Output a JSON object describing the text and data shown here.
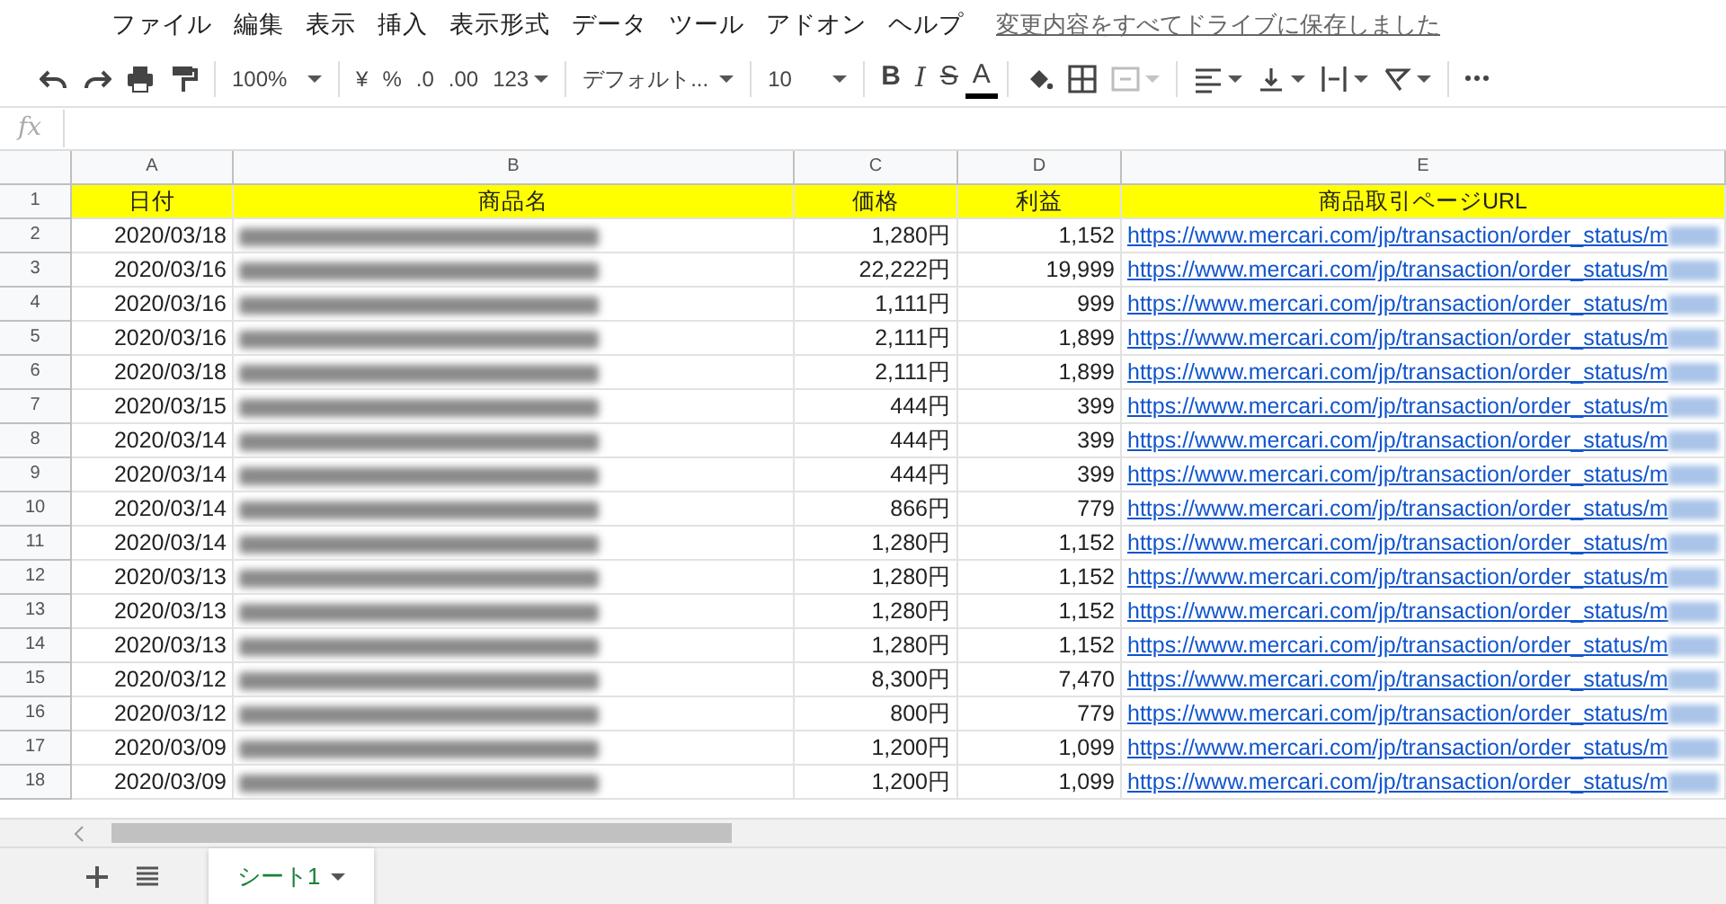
{
  "menu": [
    "ファイル",
    "編集",
    "表示",
    "挿入",
    "表示形式",
    "データ",
    "ツール",
    "アドオン",
    "ヘルプ"
  ],
  "save_status": "変更内容をすべてドライブに保存しました",
  "toolbar": {
    "zoom": "100%",
    "currency": "¥",
    "percent": "%",
    "decrease_decimals": ".0",
    "increase_decimals": ".00",
    "number_format": "123",
    "font": "デフォルト...",
    "font_size": "10",
    "bold": "B",
    "italic": "I",
    "strikethrough": "S",
    "text_color": "A",
    "merge_disabled": true
  },
  "formula_bar": {
    "label": "fx"
  },
  "columns": [
    "A",
    "B",
    "C",
    "D",
    "E"
  ],
  "header_row": {
    "number": "1",
    "cells": [
      "日付",
      "商品名",
      "価格",
      "利益",
      "商品取引ページURL"
    ]
  },
  "rows": [
    {
      "number": "2",
      "date": "2020/03/18",
      "price": "1,280円",
      "profit": "1,152",
      "url": "https://www.mercari.com/jp/transaction/order_status/m"
    },
    {
      "number": "3",
      "date": "2020/03/16",
      "price": "22,222円",
      "profit": "19,999",
      "url": "https://www.mercari.com/jp/transaction/order_status/m"
    },
    {
      "number": "4",
      "date": "2020/03/16",
      "price": "1,111円",
      "profit": "999",
      "url": "https://www.mercari.com/jp/transaction/order_status/m"
    },
    {
      "number": "5",
      "date": "2020/03/16",
      "price": "2,111円",
      "profit": "1,899",
      "url": "https://www.mercari.com/jp/transaction/order_status/m"
    },
    {
      "number": "6",
      "date": "2020/03/18",
      "price": "2,111円",
      "profit": "1,899",
      "url": "https://www.mercari.com/jp/transaction/order_status/m"
    },
    {
      "number": "7",
      "date": "2020/03/15",
      "price": "444円",
      "profit": "399",
      "url": "https://www.mercari.com/jp/transaction/order_status/m"
    },
    {
      "number": "8",
      "date": "2020/03/14",
      "price": "444円",
      "profit": "399",
      "url": "https://www.mercari.com/jp/transaction/order_status/m"
    },
    {
      "number": "9",
      "date": "2020/03/14",
      "price": "444円",
      "profit": "399",
      "url": "https://www.mercari.com/jp/transaction/order_status/m"
    },
    {
      "number": "10",
      "date": "2020/03/14",
      "price": "866円",
      "profit": "779",
      "url": "https://www.mercari.com/jp/transaction/order_status/m"
    },
    {
      "number": "11",
      "date": "2020/03/14",
      "price": "1,280円",
      "profit": "1,152",
      "url": "https://www.mercari.com/jp/transaction/order_status/m"
    },
    {
      "number": "12",
      "date": "2020/03/13",
      "price": "1,280円",
      "profit": "1,152",
      "url": "https://www.mercari.com/jp/transaction/order_status/m"
    },
    {
      "number": "13",
      "date": "2020/03/13",
      "price": "1,280円",
      "profit": "1,152",
      "url": "https://www.mercari.com/jp/transaction/order_status/m"
    },
    {
      "number": "14",
      "date": "2020/03/13",
      "price": "1,280円",
      "profit": "1,152",
      "url": "https://www.mercari.com/jp/transaction/order_status/m"
    },
    {
      "number": "15",
      "date": "2020/03/12",
      "price": "8,300円",
      "profit": "7,470",
      "url": "https://www.mercari.com/jp/transaction/order_status/m"
    },
    {
      "number": "16",
      "date": "2020/03/12",
      "price": "800円",
      "profit": "779",
      "url": "https://www.mercari.com/jp/transaction/order_status/m"
    },
    {
      "number": "17",
      "date": "2020/03/09",
      "price": "1,200円",
      "profit": "1,099",
      "url": "https://www.mercari.com/jp/transaction/order_status/m"
    },
    {
      "number": "18",
      "date": "2020/03/09",
      "price": "1,200円",
      "profit": "1,099",
      "url": "https://www.mercari.com/jp/transaction/order_status/m"
    }
  ],
  "sheet_tabs": [
    {
      "label": "シート1",
      "selected": true
    }
  ]
}
